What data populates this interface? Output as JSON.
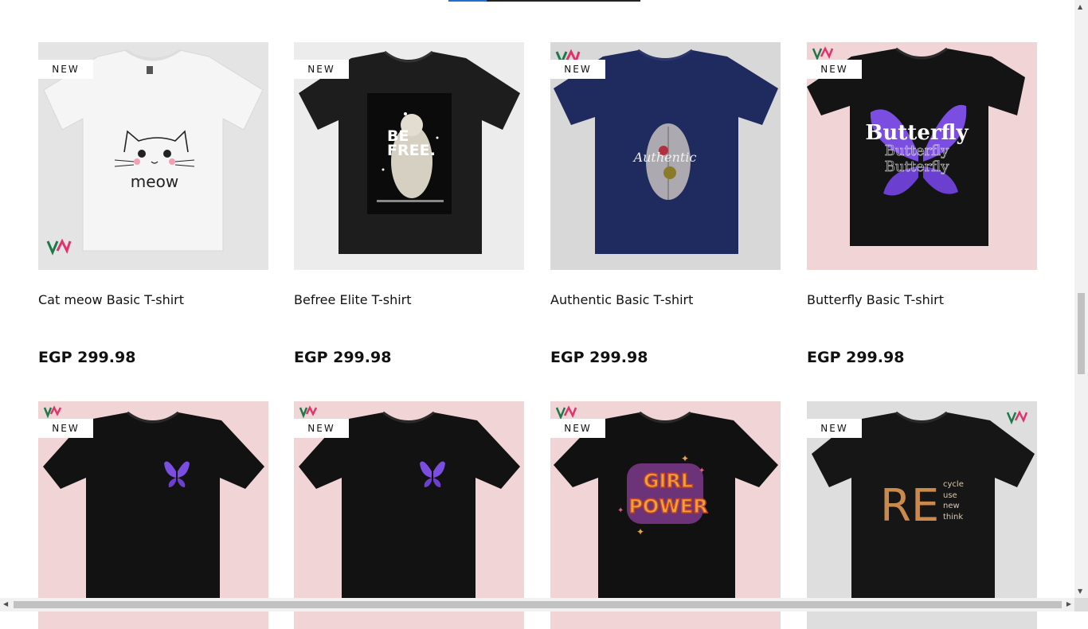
{
  "badge_label": "NEW",
  "products_row1": [
    {
      "title": "Cat meow Basic T-shirt",
      "price": "EGP 299.98",
      "bg": "#e4e4e4",
      "shirt": "#f4f4f4",
      "print": "meow"
    },
    {
      "title": "Befree Elite T-shirt",
      "price": "EGP 299.98",
      "bg": "#ececec",
      "shirt": "#1c1c1c",
      "print": "BE FREE."
    },
    {
      "title": "Authentic Basic T-shirt",
      "price": "EGP 299.98",
      "bg": "#d8d8d8",
      "shirt": "#1e2a5e",
      "print": "Authentic"
    },
    {
      "title": "Butterfly Basic T-shirt",
      "price": "EGP 299.98",
      "bg": "#f1d4d6",
      "shirt": "#151515",
      "print": "Butterfly"
    }
  ],
  "products_row2": [
    {
      "bg": "#f1d4d6",
      "shirt": "#121212",
      "print": "butterfly-small"
    },
    {
      "bg": "#f1d4d6",
      "shirt": "#121212",
      "print": "butterfly-small"
    },
    {
      "bg": "#f1d4d6",
      "shirt": "#121212",
      "print": "GIRL POWER"
    },
    {
      "bg": "#dedede",
      "shirt": "#161616",
      "print": "RE",
      "words": [
        "cycle",
        "use",
        "new",
        "think"
      ]
    }
  ],
  "colors": {
    "accent": "#1f6fd1",
    "logo_green": "#1a7a4a",
    "logo_pink": "#e0336b"
  }
}
